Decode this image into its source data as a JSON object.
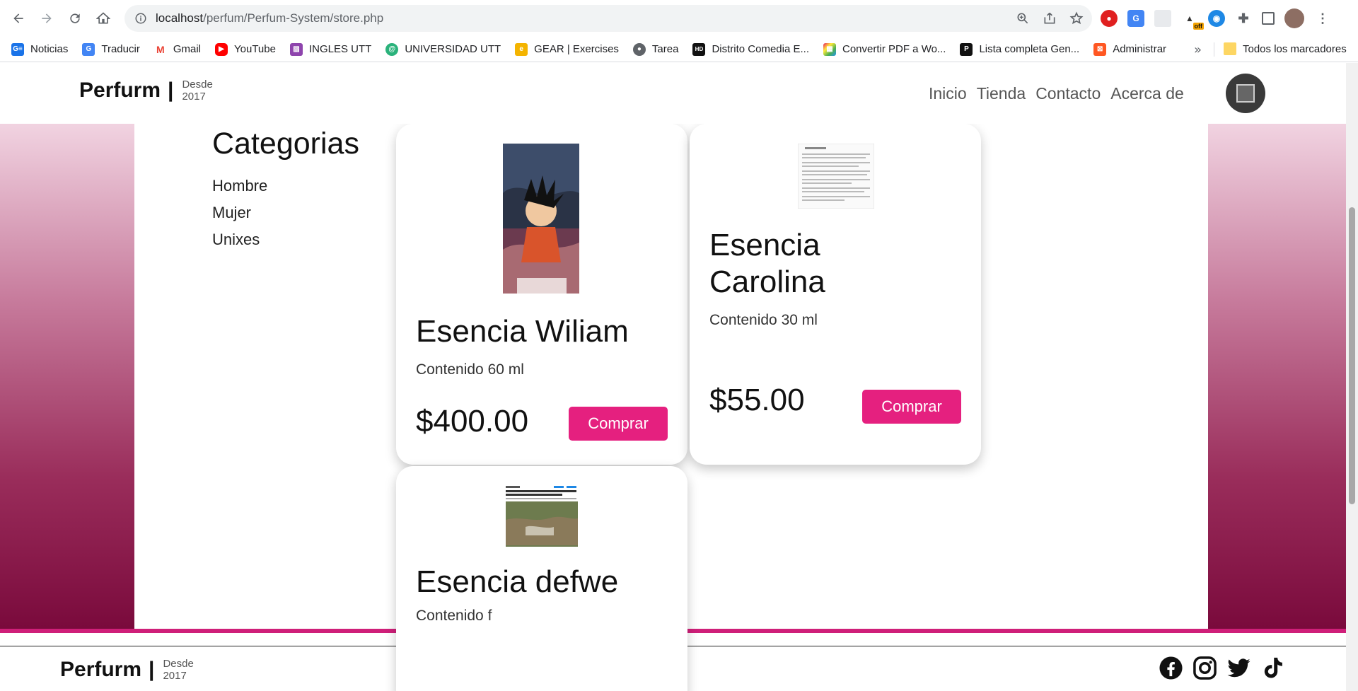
{
  "browser": {
    "url_host": "localhost",
    "url_path": "/perfum/Perfum-System/store.php",
    "ext_badge": "off",
    "bookmarks": [
      {
        "label": "Noticias",
        "color": "#1a73e8",
        "glyph": "G≡"
      },
      {
        "label": "Traducir",
        "color": "#4285f4",
        "glyph": "G"
      },
      {
        "label": "Gmail",
        "color": "#ea4335",
        "glyph": "M"
      },
      {
        "label": "YouTube",
        "color": "#ff0000",
        "glyph": "▶"
      },
      {
        "label": "INGLES UTT",
        "color": "#8e44ad",
        "glyph": "▨"
      },
      {
        "label": "UNIVERSIDAD UTT",
        "color": "#2ab27b",
        "glyph": "@"
      },
      {
        "label": "GEAR | Exercises",
        "color": "#f4b400",
        "glyph": "e"
      },
      {
        "label": "Tarea",
        "color": "#5f6368",
        "glyph": "●"
      },
      {
        "label": "Distrito Comedia E...",
        "color": "#111111",
        "glyph": "HD"
      },
      {
        "label": "Convertir PDF a Wo...",
        "color": "#e91e63",
        "glyph": "▦"
      },
      {
        "label": "Lista completa Gen...",
        "color": "#111111",
        "glyph": "P"
      },
      {
        "label": "Administrar",
        "color": "#ff5722",
        "glyph": "⊠"
      }
    ],
    "bookmarks_more": "»",
    "all_bookmarks": "Todos los marcadores"
  },
  "site": {
    "brand": "Perfurm",
    "brand_bar": "|",
    "since_label": "Desde",
    "since_year": "2017",
    "nav": [
      "Inicio",
      "Tienda",
      "Contacto",
      "Acerca de"
    ],
    "accent_color": "#e5207f"
  },
  "categories": {
    "title": "Categorias",
    "items": [
      "Hombre",
      "Mujer",
      "Unixes"
    ]
  },
  "products": [
    {
      "name": "Esencia Wiliam",
      "content": "Contenido 60 ml",
      "price": "$400.00",
      "button": "Comprar",
      "image": "anime-character-image"
    },
    {
      "name": "Esencia Carolina",
      "content": "Contenido 30 ml",
      "price": "$55.00",
      "button": "Comprar",
      "image": "document-screenshot-image"
    },
    {
      "name": "Esencia defwe",
      "content": "Contenido f",
      "price": "",
      "button": "",
      "image": "news-flood-image"
    }
  ],
  "footer": {
    "brand": "Perfurm",
    "brand_bar": "|",
    "since_label": "Desde",
    "since_year": "2017",
    "socials": [
      "facebook-icon",
      "instagram-icon",
      "twitter-icon",
      "tiktok-icon"
    ]
  }
}
